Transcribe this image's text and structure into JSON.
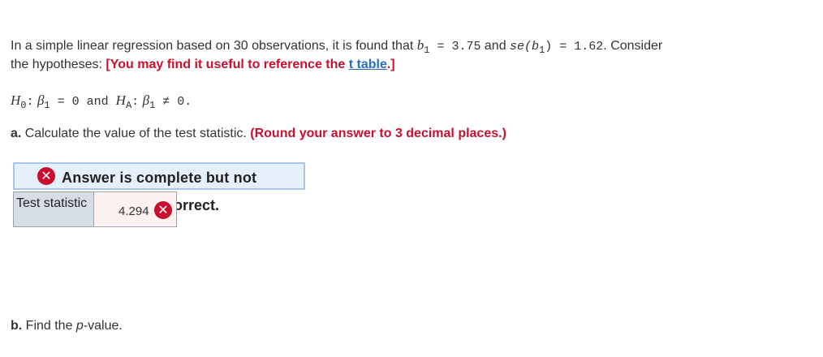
{
  "question": {
    "intro_prefix": "In a simple linear regression based on 30 observations, it is found that ",
    "b1_symbol": "b",
    "b1_sub": "1",
    "b1_equals": " = 3.75",
    "and_text": " and ",
    "se_text": "se(b",
    "se_sub": "1",
    "se_close": ")",
    "se_equals": " = 1.62",
    "intro_suffix": ". Consider",
    "line2_prefix": "the hypotheses: ",
    "hint_open": "[You may find it useful to reference the ",
    "hint_link": "t table",
    "hint_close": ".]"
  },
  "hypotheses": {
    "h0": "H",
    "h0_sub": "0",
    "colon": ":",
    "beta": "β",
    "beta_sub": "1",
    "h0_rel": " = 0",
    "and": " and ",
    "ha": "H",
    "ha_sub": "A",
    "ha_rel": " ≠ 0."
  },
  "part_a": {
    "label": "a.",
    "text": " Calculate the value of the test statistic. ",
    "instruction": "(Round your answer to 3 decimal places.)"
  },
  "feedback": {
    "banner": "Answer is complete but not correct.",
    "banner_visible": "Answer is complete but not",
    "banner_tail": "orrect.",
    "x_glyph": "✕"
  },
  "answer_table": {
    "label": "Test statistic",
    "value": "4.294"
  },
  "part_b": {
    "label": "b.",
    "text_prefix": " Find the ",
    "p": "p",
    "text_suffix": "-value."
  },
  "icons": {
    "status": "x-circle-icon"
  },
  "colors": {
    "accent_red": "#c8102e",
    "link_blue": "#2a6ebb",
    "banner_bg": "#e6f0fa"
  }
}
